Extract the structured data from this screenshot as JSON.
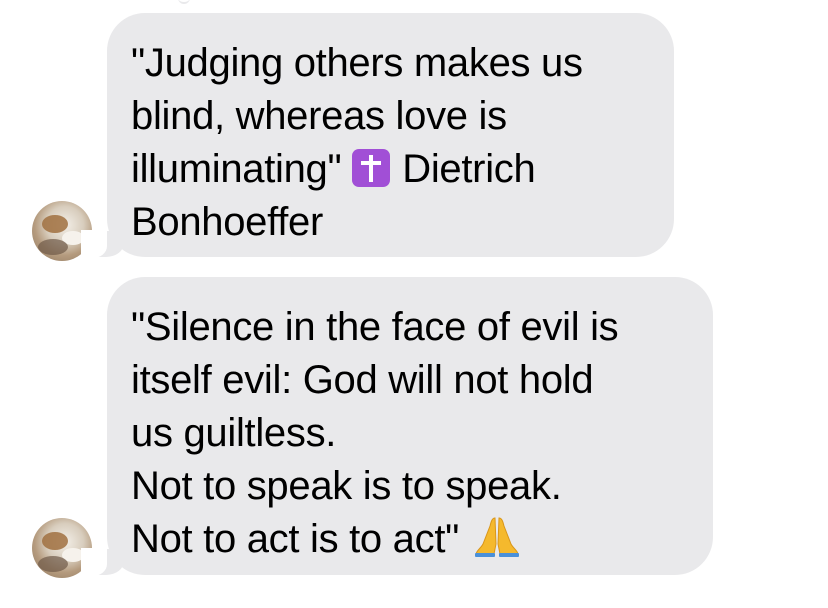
{
  "conversation": {
    "messages": [
      {
        "sender_avatar_icon": "contact-avatar-icon",
        "lines": [
          "\"Judging others makes us",
          "blind, whereas love is",
          "illuminating\"",
          "Dietrich",
          "Bonhoeffer"
        ],
        "emoji_icon": "latin-cross-emoji-icon"
      },
      {
        "sender_avatar_icon": "contact-avatar-icon",
        "lines": [
          "\"Silence in the face of evil is",
          "itself evil: God will not hold",
          "us guiltless.",
          "Not to speak is to speak.",
          "Not to act is to act\""
        ],
        "emoji_icon": "folded-hands-emoji-icon"
      }
    ]
  },
  "colors": {
    "incoming_bubble": "#e9e9eb",
    "text": "#000000",
    "cross_emoji": "#a14fd6",
    "pray_emoji": "#f5b92d"
  }
}
